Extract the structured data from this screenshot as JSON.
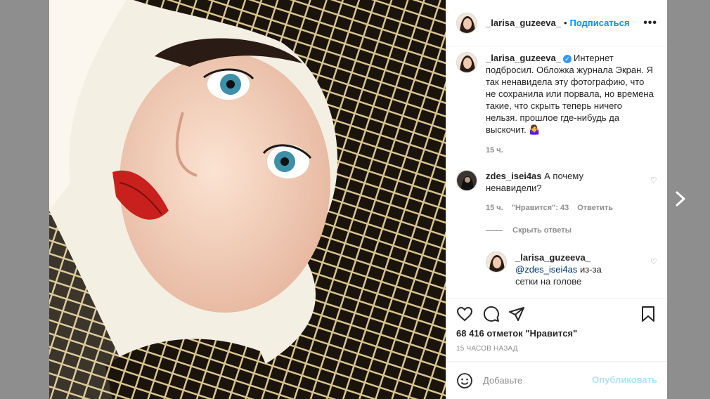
{
  "header": {
    "username": "_larisa_guzeeva_",
    "separator": "•",
    "follow_label": "Подписаться",
    "more_label": "•••"
  },
  "caption": {
    "username": "_larisa_guzeeva_",
    "verified_icon": "verified-badge-icon",
    "text": "Интернет подбросил. Обложка журнала Экран. Я так ненавидела эту фотографию, что не сохранила или порвала, но времена такие, что скрыть теперь ничего нельзя. прошлое где-нибудь да выскочит. 🤷‍♀️",
    "time": "15 ч."
  },
  "comments": [
    {
      "username": "zdes_isei4as",
      "text": "А почему ненавидели?",
      "time": "15 ч.",
      "likes": "\"Нравится\": 43",
      "reply_label": "Ответить"
    }
  ],
  "hide_replies_label": "Скрыть ответы",
  "reply": {
    "username": "_larisa_guzeeva_",
    "mention": "@zdes_isei4as",
    "text": "из-за сетки на голове"
  },
  "actions": {
    "likes_text": "68 416 отметок \"Нравится\"",
    "time_ago": "15 ЧАСОВ НАЗАД"
  },
  "add_comment": {
    "placeholder": "Добавьте",
    "publish_label": "Опубликовать"
  },
  "colors": {
    "accent": "#0095f6",
    "publish_disabled": "#b2dffc",
    "backdrop": "#8e8e8e",
    "verified": "#3897f0"
  }
}
